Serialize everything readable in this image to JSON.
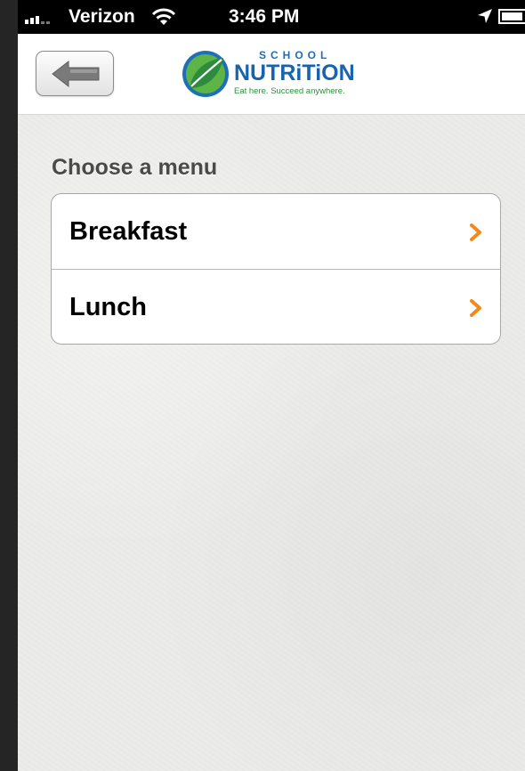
{
  "status_bar": {
    "carrier": "Verizon",
    "time": "3:46 PM",
    "battery_level": 0.9,
    "icons": [
      "signal-bars-icon",
      "wifi-icon",
      "location-arrow-icon",
      "battery-icon"
    ]
  },
  "nav_bar": {
    "back_icon": "back-arrow-icon",
    "logo": {
      "top_text": "SCHOOL",
      "main_text": "NUTRiTiON",
      "tagline": "Eat here. Succeed anywhere."
    }
  },
  "content": {
    "section_title": "Choose a menu",
    "menu_items": [
      {
        "label": "Breakfast",
        "icon": "chevron-right-icon"
      },
      {
        "label": "Lunch",
        "icon": "chevron-right-icon"
      }
    ]
  },
  "colors": {
    "accent_orange": "#f08a1c",
    "logo_blue": "#1763b0",
    "logo_green": "#2a8f3a"
  }
}
